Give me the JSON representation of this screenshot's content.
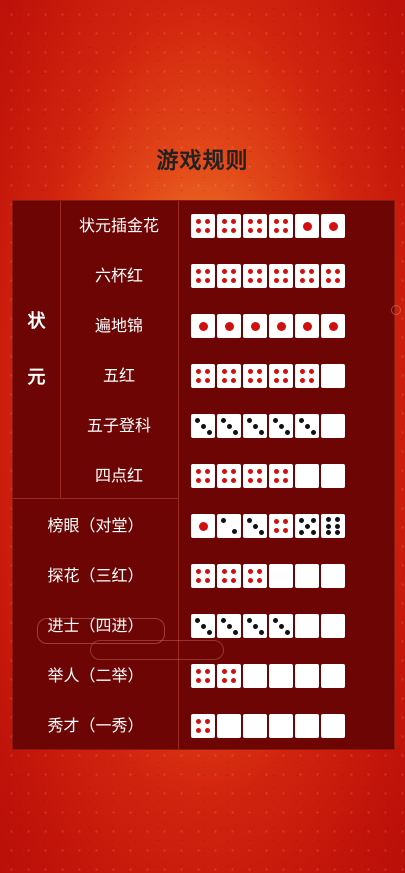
{
  "title": "游戏规则",
  "groups": [
    {
      "chars": [
        "状",
        "元"
      ]
    }
  ],
  "rows": [
    {
      "name": "状元插金花",
      "dice": [
        4,
        4,
        4,
        4,
        1,
        1
      ]
    },
    {
      "name": "六杯红",
      "dice": [
        4,
        4,
        4,
        4,
        4,
        4
      ]
    },
    {
      "name": "遍地锦",
      "dice": [
        1,
        1,
        1,
        1,
        1,
        1
      ]
    },
    {
      "name": "五红",
      "dice": [
        4,
        4,
        4,
        4,
        4,
        0
      ]
    },
    {
      "name": "五子登科",
      "dice": [
        3,
        3,
        3,
        3,
        3,
        0
      ]
    },
    {
      "name": "四点红",
      "dice": [
        4,
        4,
        4,
        4,
        0,
        0
      ]
    },
    {
      "name": "榜眼（对堂）",
      "dice": [
        1,
        2,
        3,
        4,
        5,
        6
      ]
    },
    {
      "name": "探花（三红）",
      "dice": [
        4,
        4,
        4,
        0,
        0,
        0
      ]
    },
    {
      "name": "进士（四进）",
      "dice": [
        3,
        3,
        3,
        3,
        0,
        0
      ]
    },
    {
      "name": "举人（二举）",
      "dice": [
        4,
        4,
        0,
        0,
        0,
        0
      ]
    },
    {
      "name": "秀才（一秀）",
      "dice": [
        4,
        0,
        0,
        0,
        0,
        0
      ]
    }
  ],
  "colors": {
    "pip_red": "#d20f0f",
    "pip_black": "#111111",
    "panel": "#6d0504",
    "background_center": "#f2a24a",
    "background_edge": "#b80f08"
  }
}
